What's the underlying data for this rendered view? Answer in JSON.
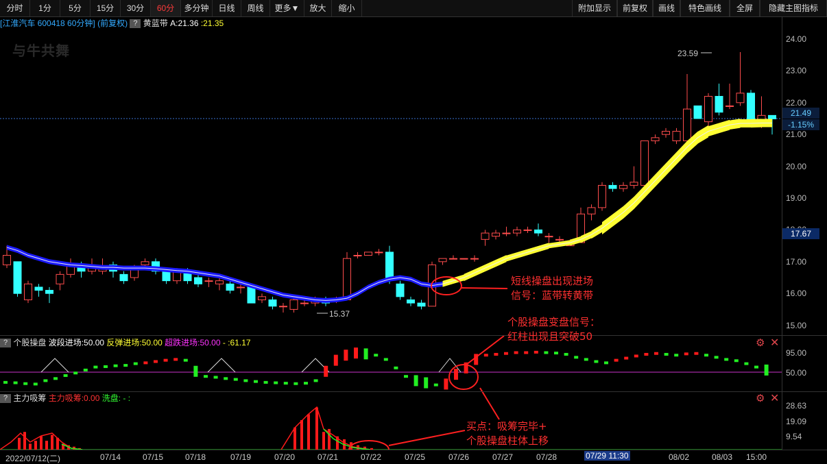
{
  "toolbar": {
    "left": [
      "分时",
      "1分",
      "5分",
      "15分",
      "30分",
      "60分",
      "多分钟",
      "日线",
      "周线",
      "更多▼",
      "放大",
      "缩小"
    ],
    "active_index": 5,
    "right": [
      "附加显示",
      "前复权",
      "画线",
      "特色画线",
      "全屏",
      "隐藏主图指标"
    ]
  },
  "stock": {
    "name": "[江淮汽车 600418 60分钟]",
    "adj": "(前复权)",
    "help": "?",
    "indicator": "黄蓝带",
    "value_a": "A:21.36",
    "value_b": ":21.35"
  },
  "logo": "与牛共舞",
  "price_axis": {
    "labels": [
      "24.00",
      "23.00",
      "22.00",
      "21.00",
      "20.00",
      "19.00",
      "18.00",
      "17.00",
      "16.00",
      "15.00"
    ],
    "current_price": "21.49",
    "change_pct": "-1.15%",
    "crosshair_price": "17.67"
  },
  "pane2": {
    "name": "个股操盘",
    "f1": "波段进场:50.00",
    "f2": "反弹进场:50.00",
    "f3": "超跌进场:50.00",
    "f4": "-  :61.17",
    "labels": [
      "95.00",
      "50.00"
    ]
  },
  "pane3": {
    "name": "主力吸筹",
    "f1": "主力吸筹:0.00",
    "f2": "洗盘: -  :",
    "labels": [
      "28.63",
      "19.09",
      "9.54"
    ]
  },
  "x_axis": {
    "labels": [
      "2022/07/12(二)",
      "07/14",
      "07/15",
      "07/18",
      "07/19",
      "07/20",
      "07/21",
      "07/22",
      "07/25",
      "07/26",
      "07/27",
      "07/28",
      "07/29 11:30",
      "08/02",
      "08/03",
      "15:00"
    ],
    "highlighted_index": 12
  },
  "annotations": {
    "high_label": "23.59",
    "low_label": "15.37",
    "note1_line1": "短线操盘出现进场",
    "note1_line2": "信号：蓝带转黄带",
    "note2_line1": "个股操盘变盘信号：",
    "note2_line2": "红柱出现且突破50",
    "note3_line1": "买点：吸筹完毕+",
    "note3_line2": "个股操盘柱体上移"
  },
  "colors": {
    "up": "#ff4d4d",
    "down": "#33ffff",
    "band_blue": "#1a1aff",
    "band_yellow": "#ffff33",
    "signal_red": "#ff1a1a",
    "signal_green": "#22ee22",
    "annotation": "#ff3030"
  }
}
